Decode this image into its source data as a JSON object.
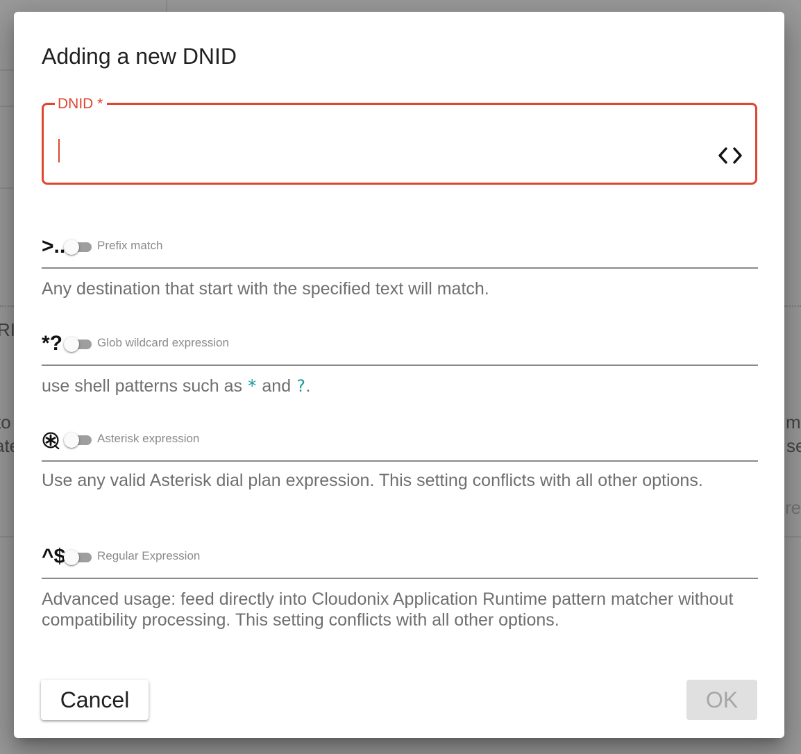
{
  "background": {
    "left_fragments": [
      "RI",
      "to",
      "ate"
    ],
    "right_fragments": [
      "m",
      "se",
      "res"
    ]
  },
  "dialog": {
    "title": "Adding a new DNID",
    "field": {
      "label": "DNID *",
      "value": "",
      "placeholder": "",
      "icon": "code-icon",
      "accent_color": "#e0452f"
    },
    "options": [
      {
        "glyph": ">..",
        "label": "Prefix match",
        "enabled": false,
        "help": "Any destination that start with the specified text will match."
      },
      {
        "glyph": "*?",
        "label": "Glob wildcard expression",
        "enabled": false,
        "help_parts": [
          "use shell patterns such as ",
          "*",
          " and ",
          "?",
          "."
        ]
      },
      {
        "glyph": "asterisk-logo-icon",
        "label": "Asterisk expression",
        "enabled": false,
        "help": "Use any valid Asterisk dial plan expression. This setting conflicts with all other options."
      },
      {
        "glyph": "^$",
        "label": "Regular Expression",
        "enabled": false,
        "help": "Advanced usage: feed directly into Cloudonix Application Runtime pattern matcher without compatibility processing. This setting conflicts with all other options."
      }
    ],
    "cancel_label": "Cancel",
    "ok_label": "OK",
    "ok_disabled": true
  }
}
